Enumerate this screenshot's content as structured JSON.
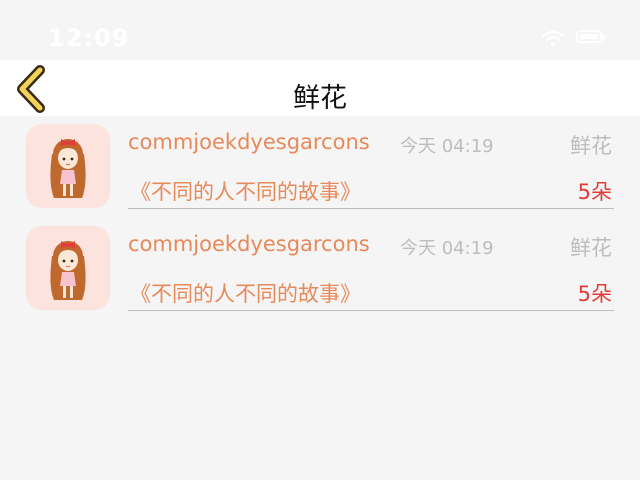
{
  "status_bar": {
    "time": "12:09"
  },
  "nav": {
    "title": "鲜花"
  },
  "colors": {
    "accent": "#e8895a",
    "count": "#e33b35",
    "muted": "#bdbdbd",
    "back_chevron": "#f3d25a"
  },
  "records": [
    {
      "username": "commjoekdyesgarcons",
      "time": "今天 04:19",
      "gift": "鲜花",
      "story": "《不同的人不同的故事》",
      "count": "5朵",
      "avatar": "girl-avatar-icon"
    },
    {
      "username": "commjoekdyesgarcons",
      "time": "今天 04:19",
      "gift": "鲜花",
      "story": "《不同的人不同的故事》",
      "count": "5朵",
      "avatar": "girl-avatar-icon"
    }
  ]
}
